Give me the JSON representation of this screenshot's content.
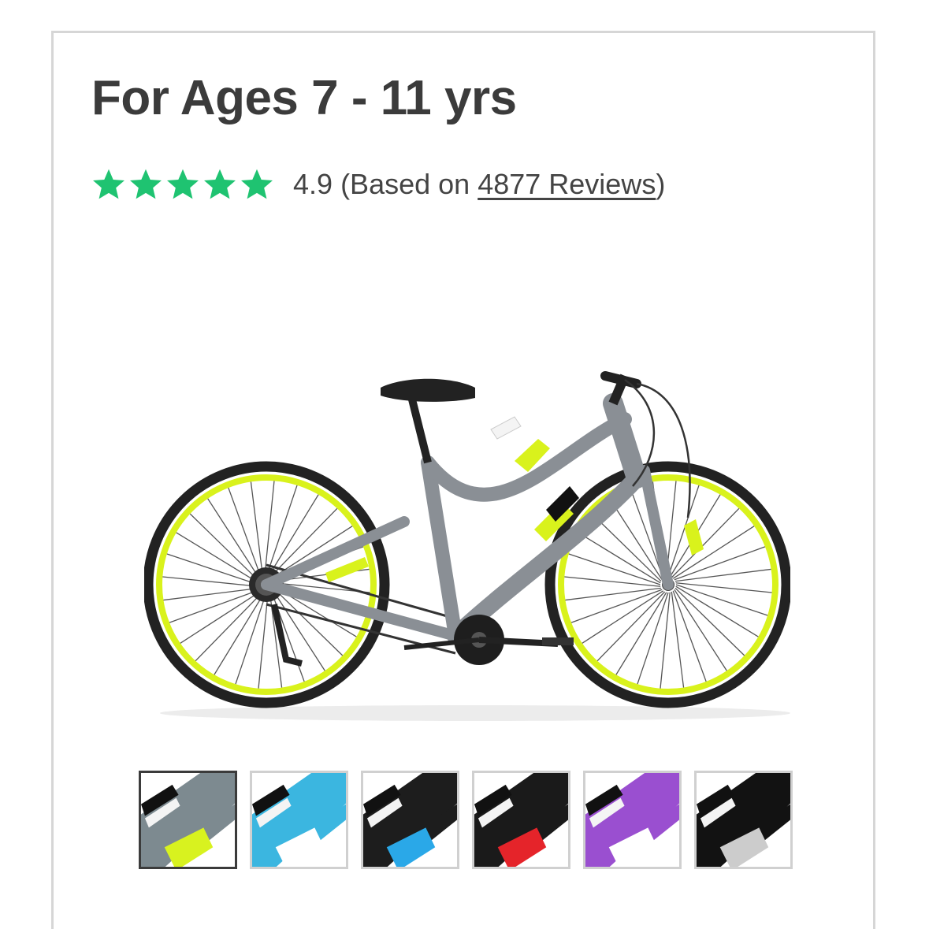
{
  "product": {
    "title": "For Ages 7 - 11 yrs",
    "rating": {
      "stars": 5,
      "star_color": "#1fc371",
      "score": "4.9",
      "prefix": "(Based on ",
      "reviews_link": "4877 Reviews",
      "suffix": ")"
    },
    "main_image": {
      "icon": "bicycle",
      "frame_color": "#8a8f95",
      "accent_color": "#d9f21c"
    },
    "color_swatches": [
      {
        "name": "gray-lime",
        "primary": "#7d8a90",
        "accent": "#d8f21f",
        "selected": true
      },
      {
        "name": "light-blue",
        "primary": "#3bb6e0",
        "accent": "#ffffff",
        "selected": false
      },
      {
        "name": "blue-green",
        "primary": "#1d1d1d",
        "accent": "#2aa8e8",
        "selected": false
      },
      {
        "name": "black-red",
        "primary": "#1a1a1a",
        "accent": "#e5242a",
        "selected": false
      },
      {
        "name": "purple",
        "primary": "#9a4fd0",
        "accent": "#ffffff",
        "selected": false
      },
      {
        "name": "black-sparkle",
        "primary": "#121212",
        "accent": "#cccccc",
        "selected": false
      }
    ]
  }
}
